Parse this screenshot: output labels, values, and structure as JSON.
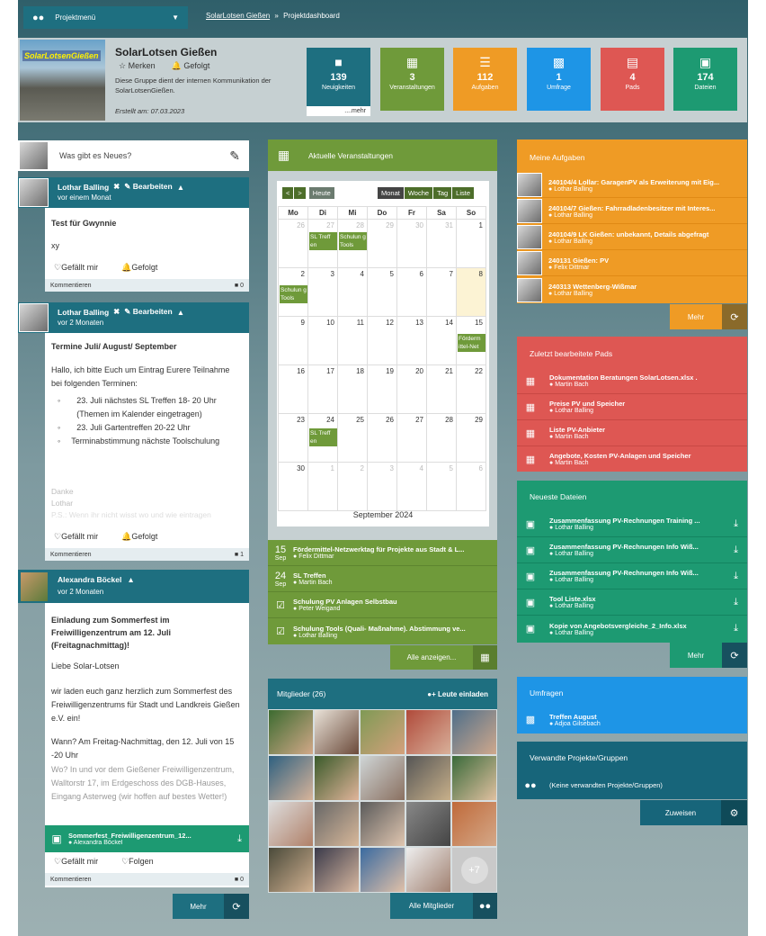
{
  "nav": {
    "menu_label": "Projektmenü",
    "breadcrumb_link": "SolarLotsen Gießen",
    "breadcrumb_sep": "»",
    "breadcrumb_current": "Projektdashboard"
  },
  "group": {
    "logo_text": "SolarLotsenGießen",
    "title": "SolarLotsen Gießen",
    "bookmark_label": "Merken",
    "follow_label": "Gefolgt",
    "description": "Diese Gruppe dient der internen Kommunikation der SolarLotsenGießen.",
    "created": "Erstellt am: 07.03.2023"
  },
  "tiles": [
    {
      "count": "139",
      "label": "Neuigkeiten",
      "extra": "....mehr",
      "color": "#1e6f80",
      "icon": "book-icon"
    },
    {
      "count": "3",
      "label": "Veranstaltungen",
      "color": "#6f9a3a",
      "icon": "calendar-icon"
    },
    {
      "count": "112",
      "label": "Aufgaben",
      "color": "#ef9b25",
      "icon": "tasks-icon"
    },
    {
      "count": "1",
      "label": "Umfrage",
      "color": "#1e95e6",
      "icon": "chart-icon"
    },
    {
      "count": "4",
      "label": "Pads",
      "color": "#de5753",
      "icon": "document-icon"
    },
    {
      "count": "174",
      "label": "Dateien",
      "color": "#1d9a72",
      "icon": "file-icon"
    }
  ],
  "feed": {
    "compose_placeholder": "Was gibt es Neues?",
    "post1": {
      "author": "Lothar Balling",
      "edit": "Bearbeiten",
      "time": "vor einem Monat",
      "title": "Test für Gwynnie",
      "body": "xy",
      "like": "Gefällt mir",
      "follow": "Gefolgt",
      "comment": "Kommentieren",
      "comments": "0"
    },
    "post2": {
      "author": "Lothar Balling",
      "edit": "Bearbeiten",
      "time": "vor 2 Monaten",
      "title": "Termine Juli/ August/ September",
      "intro": "Hallo, ich bitte Euch um Eintrag Eurere Teilnahme bei folgenden Terminen:",
      "items": [
        "23. Juli nächstes SL Treffen 18- 20 Uhr (Themen im Kalender eingetragen)",
        "23. Juli Gartentreffen 20-22 Uhr",
        "Terminabstimmung nächste Toolschulung"
      ],
      "fade": [
        "Danke",
        "Lothar",
        "P.S.: Wenn ihr nicht wisst wo und wie eintragen"
      ],
      "like": "Gefällt mir",
      "follow": "Gefolgt",
      "comment": "Kommentieren",
      "comments": "1"
    },
    "post3": {
      "author": "Alexandra Böckel",
      "time": "vor 2 Monaten",
      "title": "Einladung zum Sommerfest im Freiwilligenzentrum am 12. Juli (Freitagnachmittag)!",
      "p1": "Liebe Solar-Lotsen",
      "p2": "wir laden euch ganz herzlich zum Sommerfest des Freiwilligenzentrums für Stadt und Landkreis Gießen e.V. ein!",
      "p3": "Wann? Am Freitag-Nachmittag, den 12. Juli von 15 -20 Uhr",
      "p4": "Wo? In und vor dem Gießener Freiwilligenzentrum, Walltorstr 17, im Erdgeschoss des DGB-Hauses, Eingang Asterweg (wir hoffen auf bestes Wetter!)",
      "file": "Sommerfest_Freiwilligenzentrum_12...",
      "file_author": "Alexandra Böckel",
      "like": "Gefällt mir",
      "follow": "Folgen",
      "comment": "Kommentieren",
      "comments": "0"
    },
    "more": "Mehr"
  },
  "events": {
    "header": "Aktuelle Veranstaltungen",
    "today": "Heute",
    "views": [
      "Monat",
      "Woche",
      "Tag",
      "Liste"
    ],
    "weekdays": [
      "Mo",
      "Di",
      "Mi",
      "Do",
      "Fr",
      "Sa",
      "So"
    ],
    "month_label": "September 2024",
    "list": [
      {
        "day": "15",
        "mon": "Sep",
        "title": "Fördermittel-Netzwerktag für Projekte aus Stadt & L...",
        "who": "Felix Dittmar"
      },
      {
        "day": "24",
        "mon": "Sep",
        "title": "SL Treffen",
        "who": "Martin Bach"
      },
      {
        "day": "",
        "mon": "",
        "title": "Schulung PV Anlagen Selbstbau",
        "who": "Peter Weigand"
      },
      {
        "day": "",
        "mon": "",
        "title": "Schulung Tools (Quali- Maßnahme). Abstimmung ve...",
        "who": "Lothar Balling"
      }
    ],
    "show_all": "Alle anzeigen..."
  },
  "members": {
    "header": "Mitglieder (26)",
    "invite": "Leute einladen",
    "more_count": "+7",
    "all": "Alle Mitglieder"
  },
  "tasks": {
    "header": "Meine Aufgaben",
    "items": [
      {
        "title": "240104/4 Lollar: GaragenPV als Erweiterung mit Eig...",
        "who": "Lothar Balling"
      },
      {
        "title": "240104/7 Gießen: Fahrradladenbesitzer mit Interes...",
        "who": "Lothar Balling"
      },
      {
        "title": "240104/9 LK Gießen: unbekannt, Details abgefragt",
        "who": "Lothar Balling"
      },
      {
        "title": "240131 Gießen: PV",
        "who": "Felix Dittmar"
      },
      {
        "title": "240313 Wettenberg-Wißmar",
        "who": "Lothar Balling"
      }
    ],
    "more": "Mehr"
  },
  "pads": {
    "header": "Zuletzt bearbeitete Pads",
    "items": [
      {
        "title": "Dokumentation Beratungen SolarLotsen.xlsx .",
        "who": "Martin Bach"
      },
      {
        "title": "Preise PV und Speicher",
        "who": "Lothar Balling"
      },
      {
        "title": "Liste PV-Anbieter",
        "who": "Martin Bach"
      },
      {
        "title": "Angebote, Kosten PV-Anlagen und Speicher",
        "who": "Martin Bach"
      }
    ]
  },
  "files": {
    "header": "Neueste Dateien",
    "items": [
      {
        "title": "Zusammenfassung PV-Rechnungen Training ...",
        "who": "Lothar Balling"
      },
      {
        "title": "Zusammenfassung PV-Rechnungen Info Wiß...",
        "who": "Lothar Balling"
      },
      {
        "title": "Zusammenfassung PV-Rechnungen Info Wiß...",
        "who": "Lothar Balling"
      },
      {
        "title": "Tool Liste.xlsx",
        "who": "Lothar Balling"
      },
      {
        "title": "Kopie von Angebotsvergleiche_2_Info.xlsx",
        "who": "Lothar Balling"
      }
    ],
    "more": "Mehr"
  },
  "polls": {
    "header": "Umfragen",
    "title": "Treffen August",
    "who": "Adjoa Gilsebach"
  },
  "related": {
    "header": "Verwandte Projekte/Gruppen",
    "empty": "(Keine verwandten Projekte/Gruppen)",
    "assign": "Zuweisen"
  }
}
